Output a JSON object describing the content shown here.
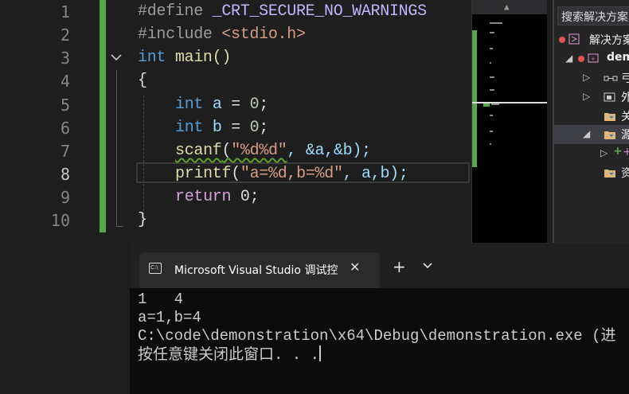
{
  "editor": {
    "line_numbers": [
      "1",
      "2",
      "3",
      "4",
      "5",
      "6",
      "7",
      "8",
      "9",
      "10"
    ],
    "lines": {
      "l1": {
        "pp": "#define",
        "macro": "_CRT_SECURE_NO_WARNINGS"
      },
      "l2": {
        "pp": "#include",
        "header": "<stdio.h>"
      },
      "l3": {
        "kw": "int",
        "rest": "main()"
      },
      "l4": {
        "text": "{"
      },
      "l5": {
        "kw": "int",
        "var": "a",
        "rest": " = ",
        "num": "0",
        "end": ";"
      },
      "l6": {
        "kw": "int",
        "var": "b",
        "rest": " = ",
        "num": "0",
        "end": ";"
      },
      "l7": {
        "fn": "scanf",
        "open": "(",
        "str": "\"%d%d\"",
        "args": ", &a,&b);"
      },
      "l8": {
        "fn": "printf",
        "open": "(",
        "str": "\"a=%d,b=%d\"",
        "args": ", a,b);"
      },
      "l9": {
        "kw": "return",
        "rest": " 0;"
      },
      "l10": {
        "text": "}"
      }
    }
  },
  "solution_explorer": {
    "search_placeholder": "搜索解决方案",
    "root_label": "解决方案",
    "project_label": "dem",
    "items": [
      "弓",
      "外",
      "关",
      "源",
      "+",
      "资"
    ]
  },
  "terminal": {
    "tab_title": "Microsoft Visual Studio 调试控",
    "close_glyph": "✕",
    "new_tab_glyph": "+",
    "dropdown_glyph": "⌄",
    "output": [
      "1   4",
      "a=1,b=4",
      "C:\\code\\demonstration\\x64\\Debug\\demonstration.exe (进",
      "按任意键关闭此窗口. . ."
    ]
  },
  "colors": {
    "change_bar": "#57a64a",
    "keyword": "#569cd6",
    "string": "#d69d85",
    "function": "#dcdcaa",
    "terminal_bg": "#0c0c0c"
  }
}
